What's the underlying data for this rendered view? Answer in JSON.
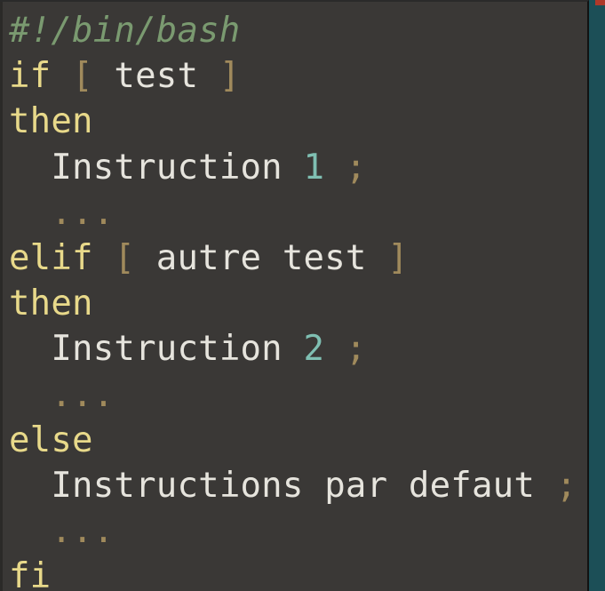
{
  "editor": {
    "lines": [
      {
        "shebang": "#!/bin/bash"
      },
      {
        "kw": "if",
        "open": "[",
        "text": " test ",
        "close": "]"
      },
      {
        "kw": "then"
      },
      {
        "indent": "  ",
        "text": "Instruction ",
        "num": "1",
        "semi": " ;"
      },
      {
        "indent": "  ",
        "dots": "..."
      },
      {
        "kw": "elif",
        "open": "[",
        "text": " autre test ",
        "close": "]"
      },
      {
        "kw": "then"
      },
      {
        "indent": "  ",
        "text": "Instruction ",
        "num": "2",
        "semi": " ;"
      },
      {
        "indent": "  ",
        "dots": "..."
      },
      {
        "kw": "else"
      },
      {
        "indent": "  ",
        "text": "Instructions par defaut",
        "semi": " ;"
      },
      {
        "indent": "  ",
        "dots": "..."
      },
      {
        "kw": "fi"
      }
    ]
  }
}
